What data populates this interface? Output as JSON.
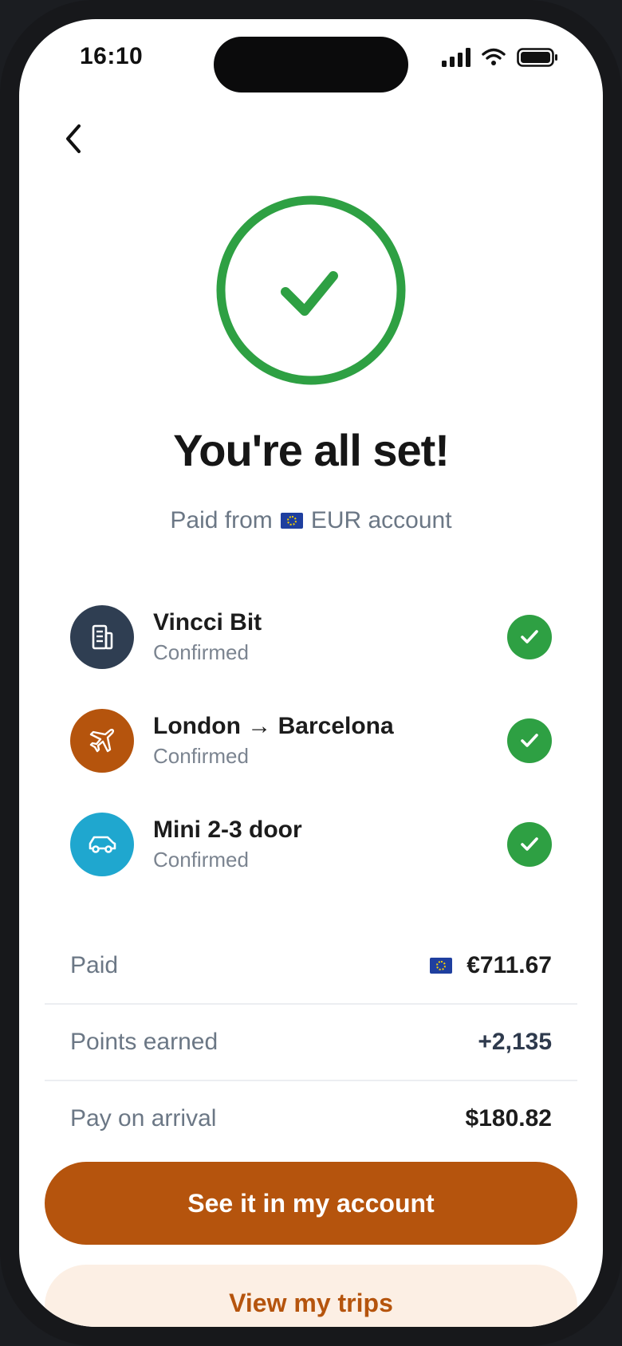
{
  "status_bar": {
    "time": "16:10"
  },
  "header": {
    "back_icon": "chevron-left-icon"
  },
  "hero": {
    "icon": "check-circle-icon",
    "title": "You're all set!",
    "subtitle_prefix": "Paid from",
    "subtitle_account": "EUR account",
    "accent": "#2ea043"
  },
  "bookings": [
    {
      "name": "Vincci Bit",
      "status": "Confirmed",
      "icon": "hotel-building-icon",
      "color": "#2f3e52"
    },
    {
      "name": "London → Barcelona",
      "status": "Confirmed",
      "icon": "airplane-icon",
      "color": "#b5540d"
    },
    {
      "name": "Mini 2-3 door",
      "status": "Confirmed",
      "icon": "car-icon",
      "color": "#1fa7cf"
    }
  ],
  "summary": {
    "paid_label": "Paid",
    "paid_value": "€711.67",
    "points_label": "Points earned",
    "points_value": "+2,135",
    "arrival_label": "Pay on arrival",
    "arrival_value": "$180.82"
  },
  "actions": {
    "primary_label": "See it in my account",
    "secondary_label": "View my trips",
    "primary_color": "#b5540d",
    "secondary_bg": "#fcefe4"
  }
}
